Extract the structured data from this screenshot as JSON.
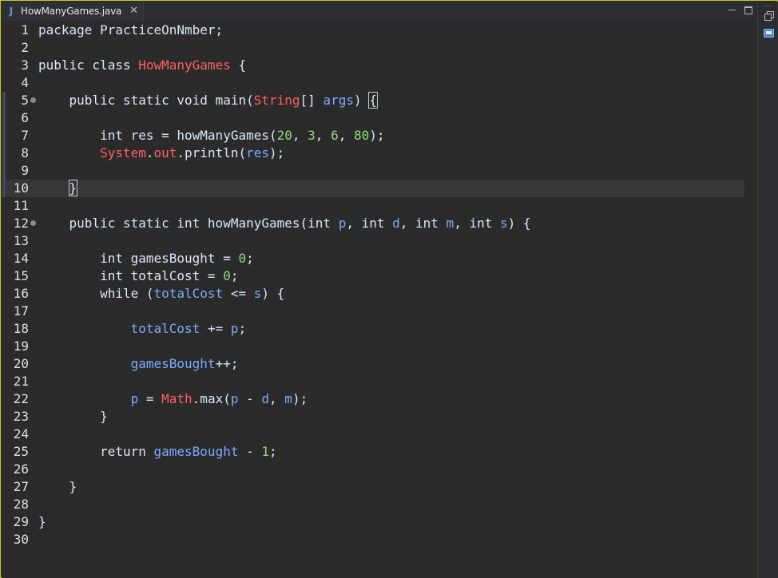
{
  "tab": {
    "icon": "java-file-icon",
    "icon_glyph": "J",
    "title": "HowManyGames.java",
    "close_glyph": "✕"
  },
  "side_panel": {
    "dots": "⋯"
  },
  "lines": [
    {
      "n": "1",
      "tokens": [
        [
          "kw",
          "package "
        ],
        [
          "plain",
          "PracticeOnNmber;"
        ]
      ]
    },
    {
      "n": "2",
      "tokens": []
    },
    {
      "n": "3",
      "tokens": [
        [
          "kw",
          "public class "
        ],
        [
          "cls",
          "HowManyGames"
        ],
        [
          "plain",
          " {"
        ]
      ]
    },
    {
      "n": "4",
      "tokens": []
    },
    {
      "n": "5",
      "fold": true,
      "tokens": [
        [
          "plain",
          "    "
        ],
        [
          "kw",
          "public static void "
        ],
        [
          "plain",
          "main("
        ],
        [
          "cls",
          "String"
        ],
        [
          "plain",
          "[] "
        ],
        [
          "var",
          "args"
        ],
        [
          "plain",
          ") "
        ],
        [
          "box",
          "{"
        ]
      ]
    },
    {
      "n": "6",
      "tokens": []
    },
    {
      "n": "7",
      "tokens": [
        [
          "plain",
          "        "
        ],
        [
          "kw",
          "int "
        ],
        [
          "plain",
          "res = howManyGames("
        ],
        [
          "num",
          "20"
        ],
        [
          "plain",
          ", "
        ],
        [
          "num",
          "3"
        ],
        [
          "plain",
          ", "
        ],
        [
          "num",
          "6"
        ],
        [
          "plain",
          ", "
        ],
        [
          "num",
          "80"
        ],
        [
          "plain",
          ");"
        ]
      ]
    },
    {
      "n": "8",
      "tokens": [
        [
          "plain",
          "        "
        ],
        [
          "cls",
          "System"
        ],
        [
          "plain",
          "."
        ],
        [
          "cls",
          "out"
        ],
        [
          "plain",
          ".println("
        ],
        [
          "var",
          "res"
        ],
        [
          "plain",
          ");"
        ]
      ]
    },
    {
      "n": "9",
      "tokens": []
    },
    {
      "n": "10",
      "current": true,
      "tokens": [
        [
          "plain",
          "    "
        ],
        [
          "box",
          "}"
        ],
        [
          "caret",
          ""
        ]
      ]
    },
    {
      "n": "11",
      "tokens": []
    },
    {
      "n": "12",
      "fold": true,
      "tokens": [
        [
          "plain",
          "    "
        ],
        [
          "kw",
          "public static int "
        ],
        [
          "plain",
          "howManyGames("
        ],
        [
          "kw",
          "int "
        ],
        [
          "var",
          "p"
        ],
        [
          "plain",
          ", "
        ],
        [
          "kw",
          "int "
        ],
        [
          "var",
          "d"
        ],
        [
          "plain",
          ", "
        ],
        [
          "kw",
          "int "
        ],
        [
          "var",
          "m"
        ],
        [
          "plain",
          ", "
        ],
        [
          "kw",
          "int "
        ],
        [
          "var",
          "s"
        ],
        [
          "plain",
          ") {"
        ]
      ]
    },
    {
      "n": "13",
      "tokens": []
    },
    {
      "n": "14",
      "tokens": [
        [
          "plain",
          "        "
        ],
        [
          "kw",
          "int "
        ],
        [
          "plain",
          "gamesBought = "
        ],
        [
          "num",
          "0"
        ],
        [
          "plain",
          ";"
        ]
      ]
    },
    {
      "n": "15",
      "tokens": [
        [
          "plain",
          "        "
        ],
        [
          "kw",
          "int "
        ],
        [
          "plain",
          "totalCost = "
        ],
        [
          "num",
          "0"
        ],
        [
          "plain",
          ";"
        ]
      ]
    },
    {
      "n": "16",
      "tokens": [
        [
          "plain",
          "        "
        ],
        [
          "kw",
          "while "
        ],
        [
          "plain",
          "("
        ],
        [
          "var",
          "totalCost"
        ],
        [
          "plain",
          " <= "
        ],
        [
          "var",
          "s"
        ],
        [
          "plain",
          ") {"
        ]
      ]
    },
    {
      "n": "17",
      "tokens": []
    },
    {
      "n": "18",
      "tokens": [
        [
          "plain",
          "            "
        ],
        [
          "var",
          "totalCost"
        ],
        [
          "plain",
          " += "
        ],
        [
          "var",
          "p"
        ],
        [
          "plain",
          ";"
        ]
      ]
    },
    {
      "n": "19",
      "tokens": []
    },
    {
      "n": "20",
      "tokens": [
        [
          "plain",
          "            "
        ],
        [
          "var",
          "gamesBought"
        ],
        [
          "plain",
          "++;"
        ]
      ]
    },
    {
      "n": "21",
      "tokens": []
    },
    {
      "n": "22",
      "tokens": [
        [
          "plain",
          "            "
        ],
        [
          "var",
          "p"
        ],
        [
          "plain",
          " = "
        ],
        [
          "cls",
          "Math"
        ],
        [
          "plain",
          ".max("
        ],
        [
          "var",
          "p"
        ],
        [
          "plain",
          " - "
        ],
        [
          "var",
          "d"
        ],
        [
          "plain",
          ", "
        ],
        [
          "var",
          "m"
        ],
        [
          "plain",
          ");"
        ]
      ]
    },
    {
      "n": "23",
      "tokens": [
        [
          "plain",
          "        }"
        ]
      ]
    },
    {
      "n": "24",
      "tokens": []
    },
    {
      "n": "25",
      "tokens": [
        [
          "plain",
          "        "
        ],
        [
          "kw",
          "return "
        ],
        [
          "var",
          "gamesBought"
        ],
        [
          "plain",
          " - "
        ],
        [
          "num",
          "1"
        ],
        [
          "plain",
          ";"
        ]
      ]
    },
    {
      "n": "26",
      "tokens": []
    },
    {
      "n": "27",
      "tokens": [
        [
          "plain",
          "    }"
        ]
      ]
    },
    {
      "n": "28",
      "tokens": []
    },
    {
      "n": "29",
      "tokens": [
        [
          "plain",
          "}"
        ]
      ]
    },
    {
      "n": "30",
      "tokens": []
    }
  ],
  "colors": {
    "background": "#2b2b2b",
    "keyword": "#d9e8f7",
    "class": "#ff6060",
    "variable": "#79abff",
    "number": "#8edc7a",
    "current_line": "#353739"
  }
}
